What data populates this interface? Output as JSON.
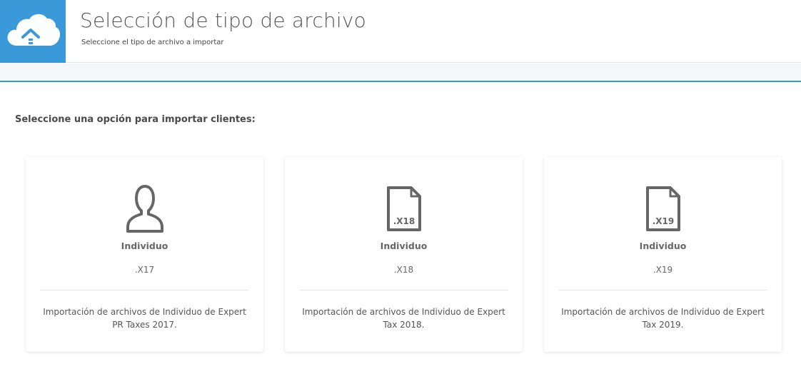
{
  "header": {
    "title": "Selección de tipo de archivo",
    "subtitle": "Seleccione el tipo de archivo a importar",
    "logo_icon": "cloud-upload-icon",
    "brand_color": "#3a9ad9"
  },
  "main": {
    "heading": "Seleccione una opción para importar clientes:",
    "cards": [
      {
        "icon": "person-icon",
        "title": "Individuo",
        "extension": ".X17",
        "description": "Importación de archivos de Individuo de Expert PR Taxes 2017."
      },
      {
        "icon": "file-x18-icon",
        "icon_label": ".X18",
        "title": "Individuo",
        "extension": ".X18",
        "description": "Importación de archivos de Individuo de Expert Tax 2018."
      },
      {
        "icon": "file-x19-icon",
        "icon_label": ".X19",
        "title": "Individuo",
        "extension": ".X19",
        "description": "Importación de archivos de Individuo de Expert Tax 2019."
      }
    ]
  }
}
